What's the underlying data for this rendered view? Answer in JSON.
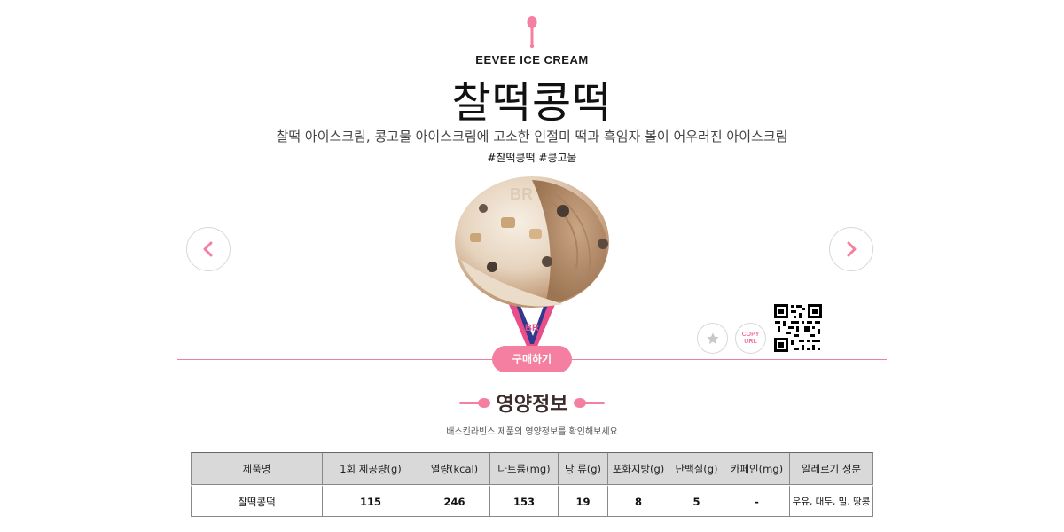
{
  "header": {
    "brand": "EEVEE ICE CREAM",
    "product_name": "찰떡콩떡",
    "description": "찰떡 아이스크림, 콩고물 아이스크림에 고소한 인절미 떡과 흑임자 볼이 어우러진 아이스크림",
    "hashtags": "#찰떡콩떡 #콩고물",
    "accent_color": "#f47fa1"
  },
  "carousel": {
    "prev_icon": "chevron-left-icon",
    "next_icon": "chevron-right-icon"
  },
  "actions": {
    "favorite_icon": "star-icon",
    "copy_url_label": "COPY\nURL",
    "qr_icon": "qr-code-icon",
    "buy_label": "구매하기"
  },
  "nutrition": {
    "title": "영양정보",
    "subtitle": "배스킨라빈스 제품의 영양정보를 확인해보세요",
    "columns": [
      "제품명",
      "1회 제공량(g)",
      "열량(kcal)",
      "나트륨(mg)",
      "당 류(g)",
      "포화지방(g)",
      "단백질(g)",
      "카페인(mg)",
      "알레르기 성분"
    ],
    "row": [
      "찰떡콩떡",
      "115",
      "246",
      "153",
      "19",
      "8",
      "5",
      "-",
      "우유, 대두, 밀, 땅콩"
    ]
  }
}
